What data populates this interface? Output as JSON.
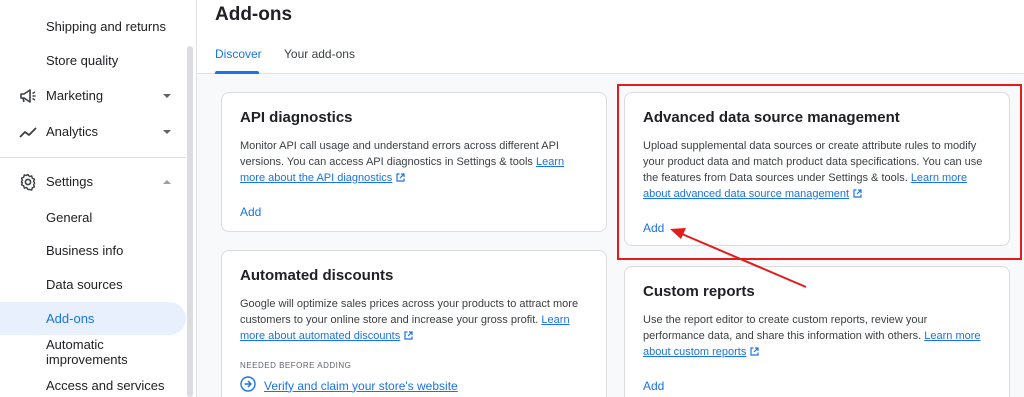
{
  "sidebar": {
    "items": [
      {
        "label": "Shipping and returns"
      },
      {
        "label": "Store quality"
      },
      {
        "label": "Marketing"
      },
      {
        "label": "Analytics"
      },
      {
        "label": "Settings"
      },
      {
        "label": "General"
      },
      {
        "label": "Business info"
      },
      {
        "label": "Data sources"
      },
      {
        "label": "Add-ons"
      },
      {
        "label": "Automatic improvements"
      },
      {
        "label": "Access and services"
      }
    ]
  },
  "header": {
    "title": "Add-ons",
    "tabs": [
      {
        "label": "Discover"
      },
      {
        "label": "Your add-ons"
      }
    ]
  },
  "cards": {
    "api": {
      "title": "API diagnostics",
      "desc": "Monitor API call usage and understand errors across different API versions. You can access API diagnostics in Settings & tools ",
      "link": "Learn more about the API diagnostics",
      "add": "Add"
    },
    "advanced": {
      "title": "Advanced data source management",
      "desc": "Upload supplemental data sources or create attribute rules to modify your product data and match product data specifications. You can use the features from Data sources under Settings & tools. ",
      "link": "Learn more about advanced data source management",
      "add": "Add"
    },
    "discounts": {
      "title": "Automated discounts",
      "desc": "Google will optimize sales prices across your products to attract more customers to your online store and increase your gross profit. ",
      "link": "Learn more about automated discounts",
      "needed": "NEEDED BEFORE ADDING",
      "verify": "Verify and claim your store's website"
    },
    "reports": {
      "title": "Custom reports",
      "desc": "Use the report editor to create custom reports, review your performance data, and share this information with others. ",
      "link": "Learn more about custom reports",
      "add": "Add"
    }
  },
  "colors": {
    "accent": "#1a73e8",
    "annotation": "#e31b1b",
    "active_bg": "#e8f0fe"
  }
}
